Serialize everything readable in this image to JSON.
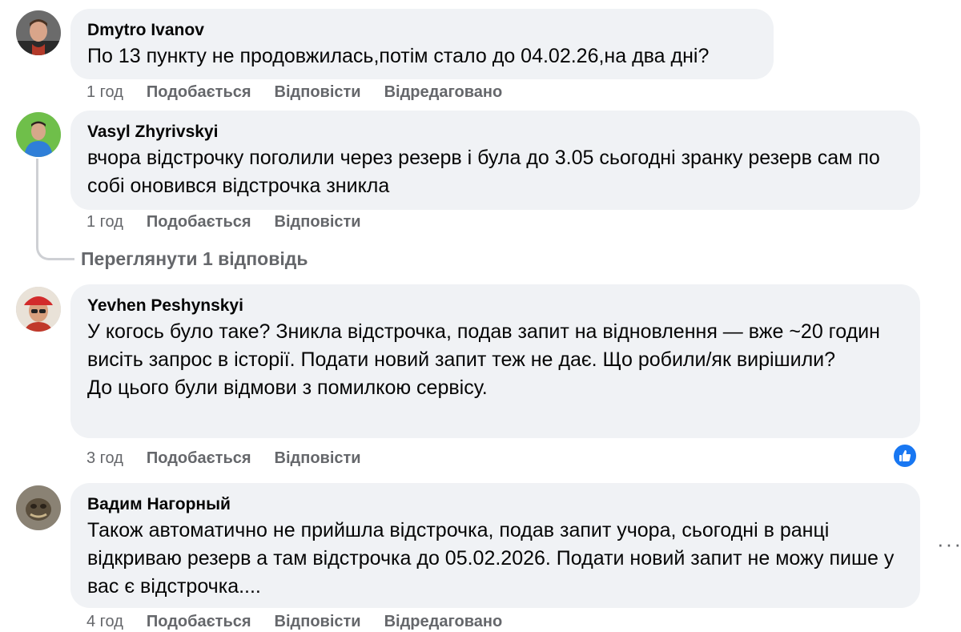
{
  "comments": [
    {
      "author": "Dmytro Ivanov",
      "text": [
        "По 13 пункту не продовжилась,потім стало до 04.02.26,на два дні?"
      ],
      "time": "1 год",
      "like": "Подобається",
      "reply": "Відповісти",
      "edited": "Відредаговано"
    },
    {
      "author": "Vasyl Zhyrivskyi",
      "text": [
        "вчора відстрочку поголили через резерв і була до 3.05 сьогодні зранку резерв сам по собі оновився відстрочка зникла"
      ],
      "time": "1 год",
      "like": "Подобається",
      "reply": "Відповісти",
      "view_replies": "Переглянути 1 відповідь"
    },
    {
      "author": "Yevhen Peshynskyi",
      "text": [
        "У когось було таке? Зникла відстрочка, подав запит на відновлення — вже ~20 годин висіть запрос в історії. Подати новий запит теж не дає. Що робили/як вирішили?",
        "До цього були відмови з помилкою сервісу."
      ],
      "time": "3 год",
      "like": "Подобається",
      "reply": "Відповісти",
      "reaction": "like-reaction-icon"
    },
    {
      "author": "Вадим Нагорный",
      "text": [
        "Також автоматично не прийшла відстрочка, подав запит учора, сьогодні в ранці відкриваю резерв а там відстрочка до 05.02.2026. Подати новий запит не можу пише у вас є відстрочка...."
      ],
      "time": "4 год",
      "like": "Подобається",
      "reply": "Відповісти",
      "edited": "Відредаговано",
      "more": "···"
    }
  ],
  "colors": {
    "bubble": "#f0f2f5",
    "secondary_text": "#65676b",
    "like_blue": "#1877f2"
  }
}
